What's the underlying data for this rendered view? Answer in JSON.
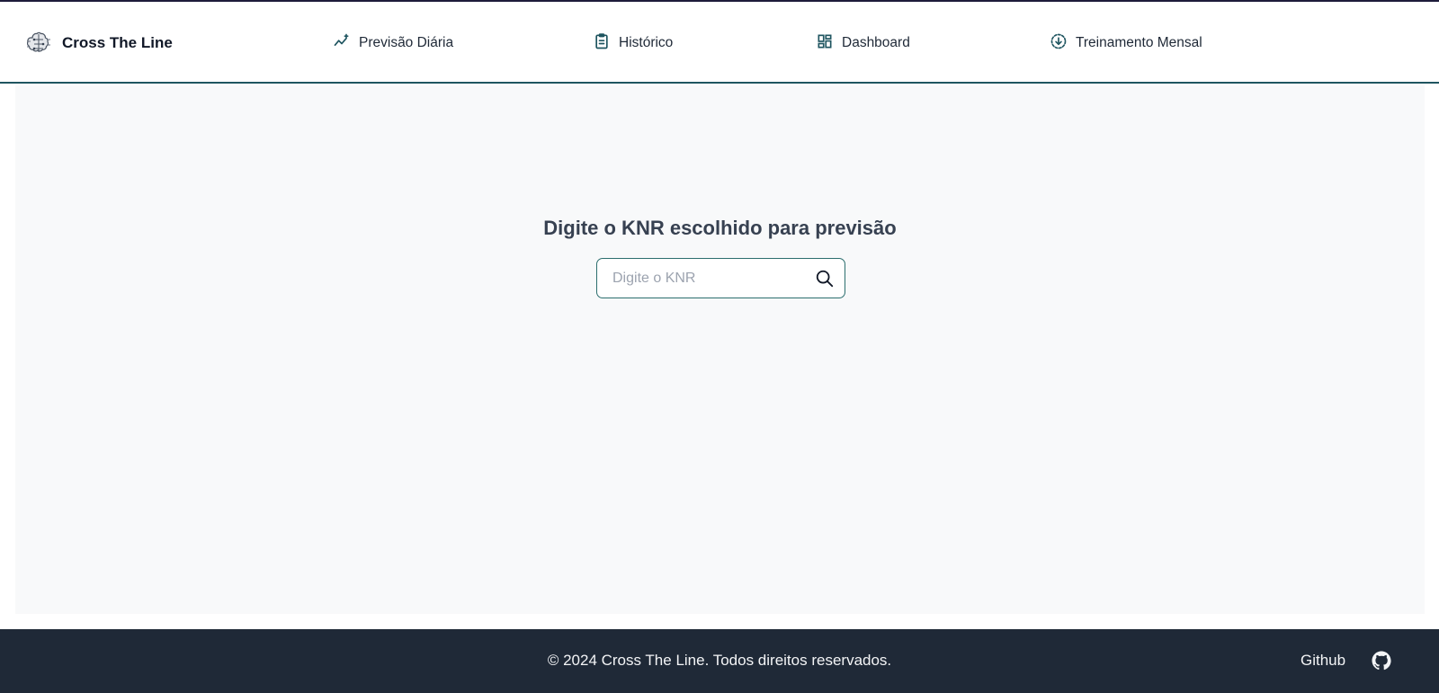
{
  "brand": {
    "name": "Cross The Line",
    "logo_icon": "brain-circuit-icon"
  },
  "nav": {
    "items": [
      {
        "label": "Previsão Diária",
        "icon": "trend-sparkle-icon"
      },
      {
        "label": "Histórico",
        "icon": "clipboard-icon"
      },
      {
        "label": "Dashboard",
        "icon": "dashboard-icon"
      },
      {
        "label": "Treinamento Mensal",
        "icon": "download-circle-icon"
      }
    ]
  },
  "main": {
    "title": "Digite o KNR escolhido para previsão",
    "search": {
      "placeholder": "Digite o KNR",
      "value": "",
      "icon": "search-icon"
    }
  },
  "footer": {
    "copyright": "© 2024 Cross The Line. Todos direitos reservados.",
    "github_label": "Github",
    "github_icon": "github-icon"
  },
  "colors": {
    "accent": "#1f5560",
    "footer_bg": "#1f2937",
    "main_bg": "#f8f9fa",
    "input_border": "#2c6e6e"
  }
}
